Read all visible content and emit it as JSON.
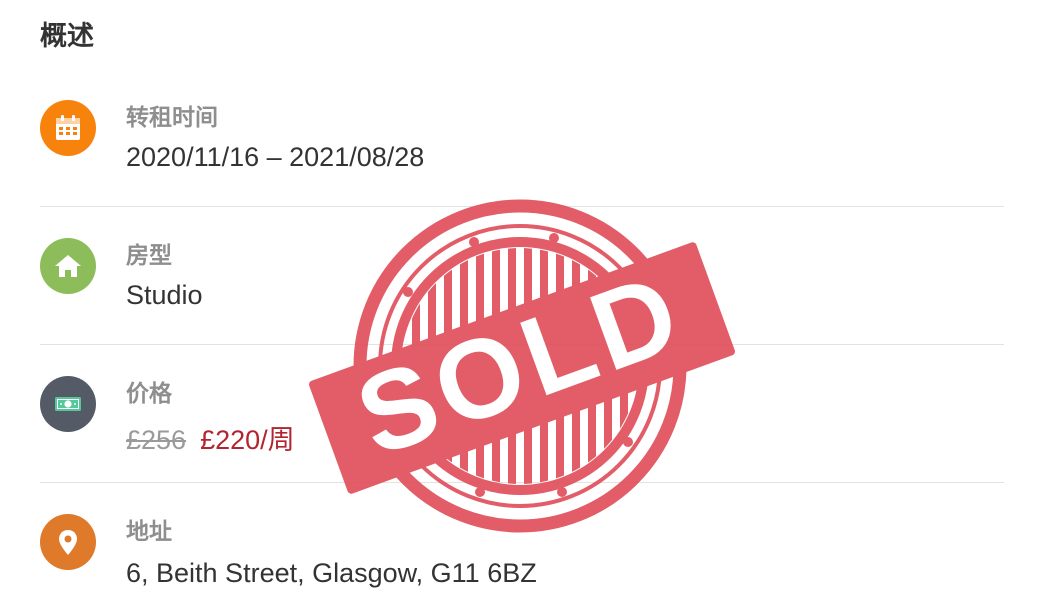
{
  "overview": {
    "title": "概述"
  },
  "rows": [
    {
      "label": "转租时间",
      "value": "2020/11/16 – 2021/08/28",
      "icon": "calendar-icon",
      "icon_color": "#f7820c"
    },
    {
      "label": "房型",
      "value": "Studio",
      "icon": "house-icon",
      "icon_color": "#8dbd5b"
    },
    {
      "label": "价格",
      "old_price": "£256",
      "new_price": "£220/周",
      "icon": "money-icon",
      "icon_color": "#555b66"
    },
    {
      "label": "地址",
      "value": "6, Beith Street, Glasgow, G11 6BZ",
      "icon": "location-pin-icon",
      "icon_color": "#de7a2a"
    }
  ],
  "stamp": {
    "text": "SOLD",
    "color": "#e0505c"
  },
  "colors": {
    "new_price": "#b2242f",
    "old_price": "#9a9a9a",
    "divider": "#e2e2e2"
  }
}
